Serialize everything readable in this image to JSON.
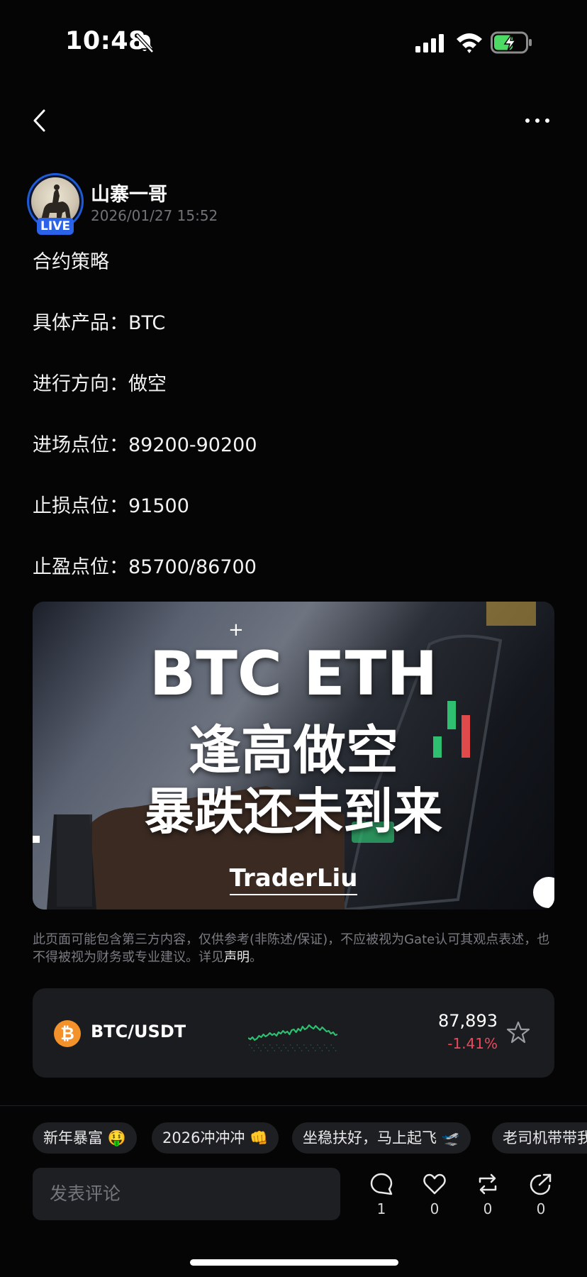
{
  "status_bar": {
    "time": "10:48",
    "icons": [
      "bell-slash-icon",
      "signal-icon",
      "wifi-icon",
      "battery-charging-icon"
    ]
  },
  "nav": {
    "back_icon": "chevron-left-icon",
    "more_icon": "ellipsis-icon"
  },
  "author": {
    "name": "山寨一哥",
    "timestamp": "2026/01/27 15:52",
    "live_badge": "LIVE"
  },
  "post": {
    "lines": [
      "合约策略",
      "具体产品：BTC",
      "进行方向：做空",
      "进场点位：89200-90200",
      "止损点位：91500",
      "止盈点位：85700/86700"
    ]
  },
  "banner": {
    "line1": "BTC ETH",
    "line2": "逢高做空",
    "line3": "暴跌还未到来",
    "brand": "TraderLiu"
  },
  "disclaimer": {
    "text": "此页面可能包含第三方内容，仅供参考(非陈述/保证)，不应被视为Gate认可其观点表述，也不得被视为财务或专业建议。详见",
    "link": "声明",
    "end": "。"
  },
  "ticker": {
    "coin_symbol": "₿",
    "pair": "BTC/USDT",
    "price": "87,893",
    "change": "-1.41%",
    "change_color": "#f0465a",
    "spark_color": "#2fbf71",
    "star_icon": "star-outline-icon"
  },
  "chips": [
    "新年暴富 🤑",
    "2026冲冲冲 👊",
    "坐稳扶好，马上起飞 🛫",
    "老司机带带我"
  ],
  "comment_bar": {
    "placeholder": "发表评论",
    "actions": [
      {
        "icon": "comment-icon",
        "count": "1"
      },
      {
        "icon": "heart-icon",
        "count": "0"
      },
      {
        "icon": "repost-icon",
        "count": "0"
      },
      {
        "icon": "share-icon",
        "count": "0"
      }
    ]
  }
}
